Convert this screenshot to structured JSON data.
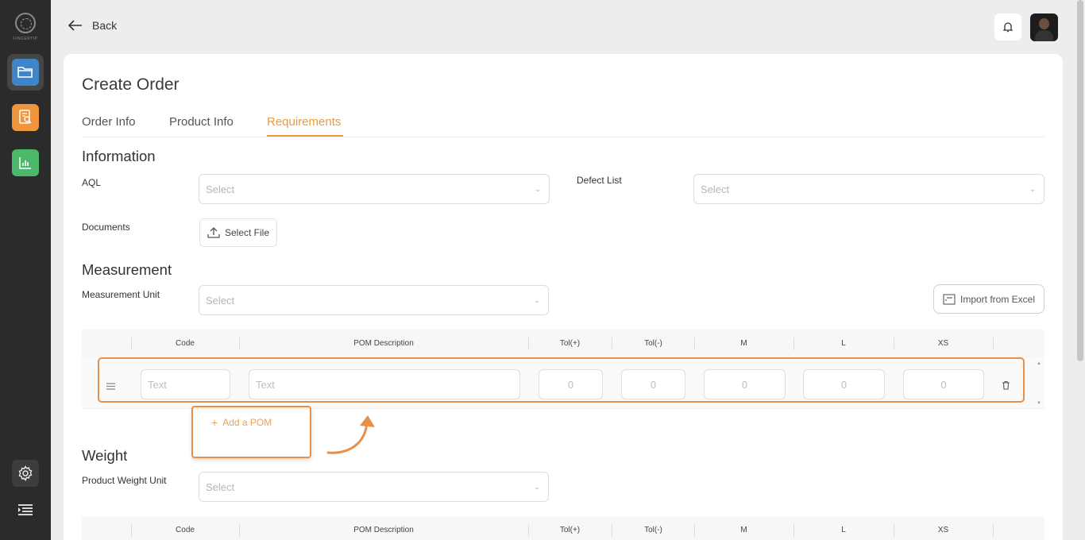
{
  "sidebar": {
    "logo_text": "FINGERTIP",
    "colors": {
      "folder": "#3e86c9",
      "report": "#f0953a",
      "chart": "#4cb86a"
    }
  },
  "header": {
    "back_label": "Back"
  },
  "page": {
    "title": "Create Order",
    "tabs": [
      {
        "label": "Order Info"
      },
      {
        "label": "Product Info"
      },
      {
        "label": "Requirements",
        "active": true
      }
    ]
  },
  "information": {
    "heading": "Information",
    "aql_label": "AQL",
    "aql_placeholder": "Select",
    "defect_label": "Defect  List",
    "defect_placeholder": "Select",
    "documents_label": "Documents",
    "select_file_label": "Select File"
  },
  "measurement": {
    "heading": "Measurement",
    "unit_label": "Measurement Unit",
    "unit_placeholder": "Select",
    "import_label": "Import from Excel",
    "columns": [
      "Code",
      "POM Description",
      "Tol(+)",
      "Tol(-)",
      "M",
      "L",
      "XS"
    ],
    "row": {
      "code_placeholder": "Text",
      "desc_placeholder": "Text",
      "tol_plus": "0",
      "tol_minus": "0",
      "m": "0",
      "l": "0",
      "xs": "0"
    },
    "add_pom_label": "Add a POM"
  },
  "weight": {
    "heading": "Weight",
    "unit_label": "Product Weight Unit",
    "unit_placeholder": "Select",
    "columns": [
      "Code",
      "POM Description",
      "Tol(+)",
      "Tol(-)",
      "M",
      "L",
      "XS"
    ]
  },
  "accent_color": "#e99a3c"
}
